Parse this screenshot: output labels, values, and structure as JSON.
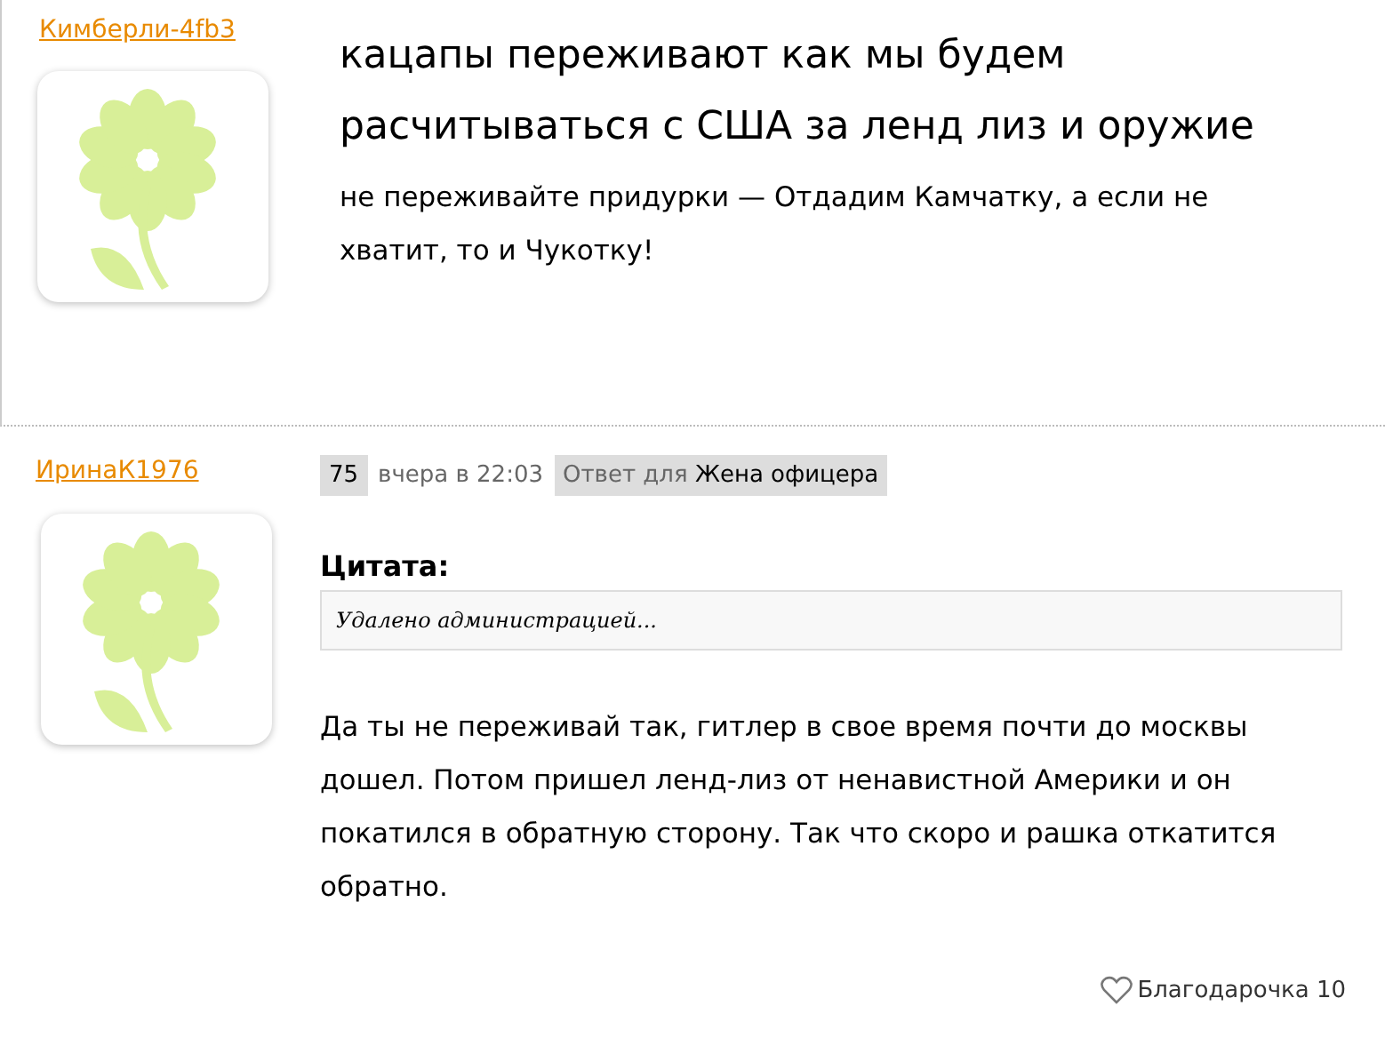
{
  "posts": [
    {
      "author": "Кимберли-4fb3",
      "title": "кацапы переживают как мы будем расчитываться с США за ленд лиз и оружие",
      "body": "не переживайте придурки — Отдадим Камчатку, а если не хватит, то и Чукотку!"
    },
    {
      "author": "ИринаК1976",
      "number": "75",
      "time": "вчера в 22:03",
      "reply_prefix": "Ответ для",
      "reply_to": "Жена офицера",
      "quote_label": "Цитата:",
      "quote": "Удалено администрацией...",
      "body": "Да ты не переживай так, гитлер в свое время почти до москвы дошел. Потом пришел ленд-лиз от ненавистной Америки и он покатился в обратную сторону. Так что скоро и рашка откатится обратно.",
      "thanks": "Благодарочка 10"
    }
  ]
}
